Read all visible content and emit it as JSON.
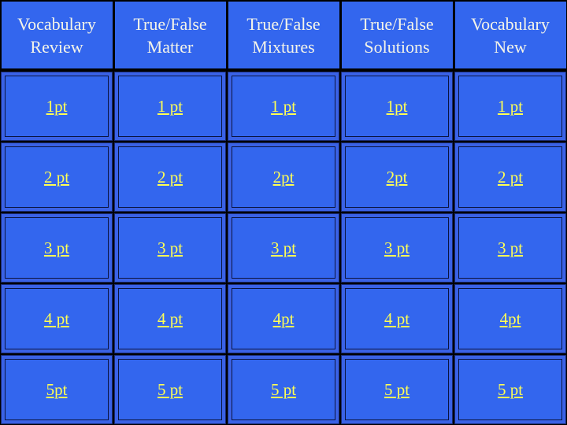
{
  "categories": [
    {
      "line1": "Vocabulary",
      "line2": "Review"
    },
    {
      "line1": "True/False",
      "line2": "Matter"
    },
    {
      "line1": "True/False",
      "line2": "Mixtures"
    },
    {
      "line1": "True/False",
      "line2": "Solutions"
    },
    {
      "line1": "Vocabulary",
      "line2": "New"
    }
  ],
  "rows": [
    [
      "1pt",
      "1 pt",
      "1 pt",
      "1pt",
      "1 pt"
    ],
    [
      "2 pt",
      "2 pt",
      "2pt",
      "2pt",
      "2 pt"
    ],
    [
      "3 pt",
      "3 pt",
      "3 pt",
      "3 pt",
      "3 pt"
    ],
    [
      "4 pt",
      "4 pt",
      "4pt",
      "4 pt",
      "4pt"
    ],
    [
      "5pt",
      "5 pt",
      "5 pt",
      "5 pt",
      "5 pt"
    ]
  ],
  "colors": {
    "tile": "#3366ee",
    "link": "#ffff55",
    "header_text": "#f4f4e8",
    "background": "#000000"
  }
}
